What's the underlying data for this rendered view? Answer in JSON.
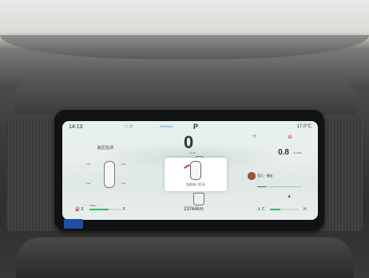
{
  "cluster": {
    "time": "14:13",
    "mode": "NORMAL",
    "gear": "P",
    "outside_temp": "17.0°C",
    "speed": "0",
    "speed_unit": "km/h",
    "tire_pressure_title": "胎压监测",
    "tire_pressures": [
      "-- bar",
      "-- bar",
      "-- bar",
      "-- bar"
    ],
    "trip": "0.8",
    "trip_unit": "km/kWh",
    "popup_text": "左前车门打开",
    "total_odometer": "23764km",
    "fuel_label": "E",
    "fuel_full_label": "F",
    "fuel_range": "545km",
    "fuel_level": 0.6,
    "music_title": "音乐 · 播放",
    "battery_label": "C",
    "battery_full_label": "H",
    "battery_level": 0.35,
    "music_progress": 0.2,
    "colors": {
      "accent_green": "#3bb36a",
      "alert_red": "#d33333",
      "mode_blue": "#3a89c9"
    }
  }
}
